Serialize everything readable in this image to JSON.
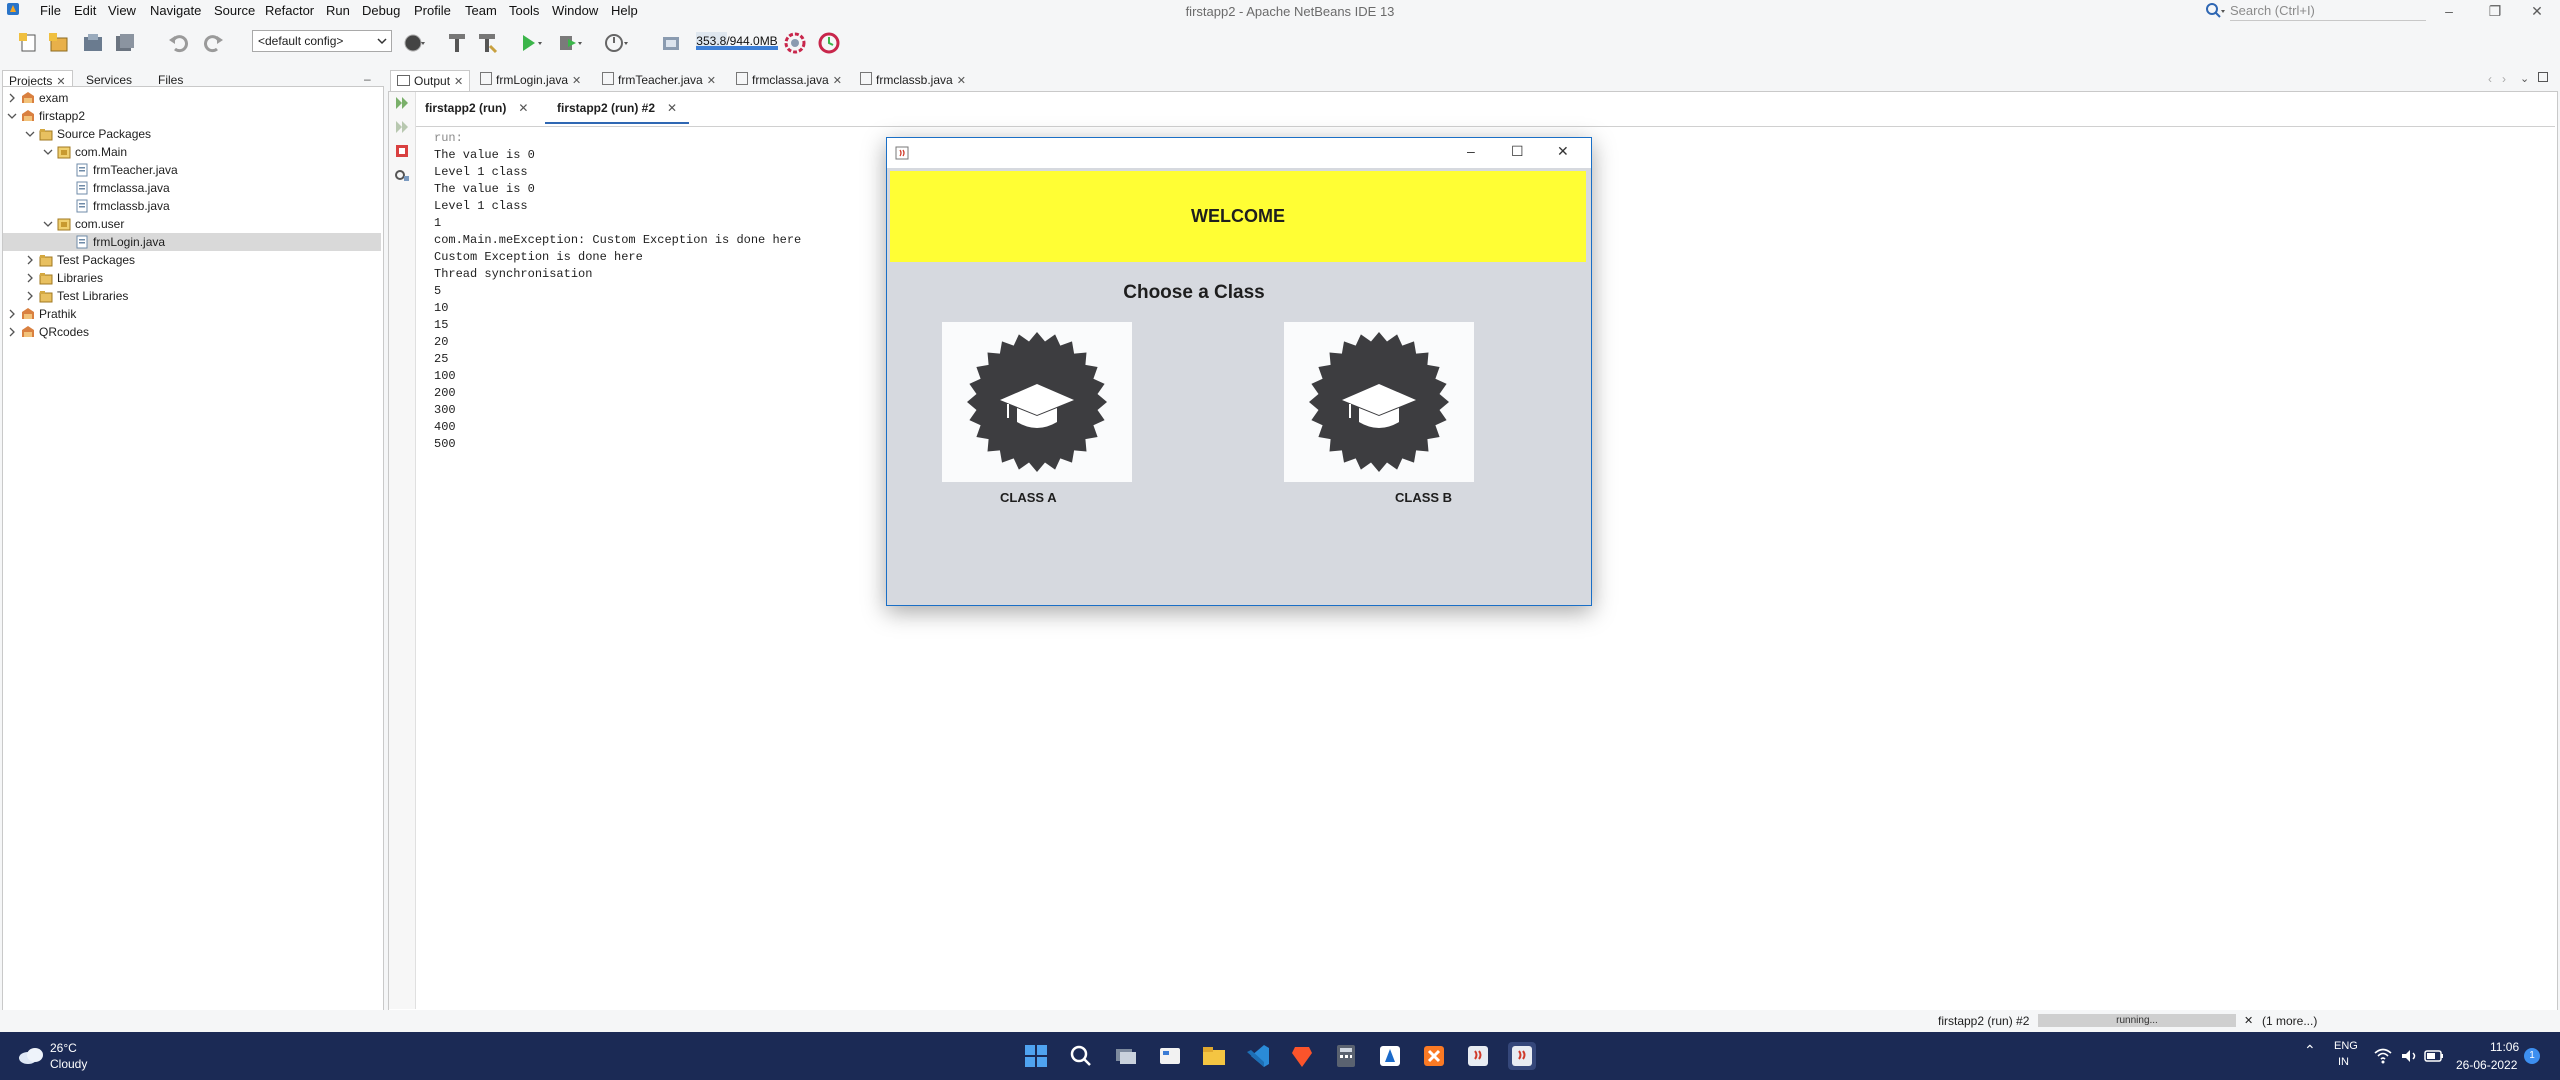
{
  "app": {
    "title": "firstapp2 - Apache NetBeans IDE 13",
    "menu": [
      "File",
      "Edit",
      "View",
      "Navigate",
      "Source",
      "Refactor",
      "Run",
      "Debug",
      "Profile",
      "Team",
      "Tools",
      "Window",
      "Help"
    ],
    "search_placeholder": "Search (Ctrl+I)",
    "window_controls": [
      "–",
      "❐",
      "✕"
    ]
  },
  "toolbar": {
    "config": "<default config>",
    "memory": "353.8/944.0MB",
    "memory_fraction": 0.375,
    "icons": [
      "new-file-icon",
      "new-project-icon",
      "open-project-icon",
      "save-all-icon",
      "undo-icon",
      "redo-icon",
      "globe-icon",
      "build-icon",
      "clean-build-icon",
      "run-icon",
      "debug-icon",
      "profile-icon",
      "memory-icon",
      "gc-icon",
      "profile-snapshot-icon"
    ]
  },
  "project_tabs": [
    {
      "label": "Projects",
      "active": true,
      "closable": true
    },
    {
      "label": "Services",
      "active": false,
      "closable": false
    },
    {
      "label": "Files",
      "active": false,
      "closable": false
    }
  ],
  "project_tree": [
    {
      "label": "exam",
      "depth": 0,
      "expanded": false,
      "icon": "project-icon"
    },
    {
      "label": "firstapp2",
      "depth": 0,
      "expanded": true,
      "icon": "project-icon"
    },
    {
      "label": "Source Packages",
      "depth": 1,
      "expanded": true,
      "icon": "folder-icon"
    },
    {
      "label": "com.Main",
      "depth": 2,
      "expanded": true,
      "icon": "package-icon"
    },
    {
      "label": "frmTeacher.java",
      "depth": 3,
      "icon": "java-file-icon"
    },
    {
      "label": "frmclassa.java",
      "depth": 3,
      "icon": "java-file-icon"
    },
    {
      "label": "frmclassb.java",
      "depth": 3,
      "icon": "java-file-icon"
    },
    {
      "label": "com.user",
      "depth": 2,
      "expanded": true,
      "icon": "package-icon"
    },
    {
      "label": "frmLogin.java",
      "depth": 3,
      "icon": "java-file-icon",
      "selected": true
    },
    {
      "label": "Test Packages",
      "depth": 1,
      "expanded": false,
      "icon": "folder-icon"
    },
    {
      "label": "Libraries",
      "depth": 1,
      "expanded": false,
      "icon": "folder-icon"
    },
    {
      "label": "Test Libraries",
      "depth": 1,
      "expanded": false,
      "icon": "folder-icon"
    },
    {
      "label": "Prathik",
      "depth": 0,
      "expanded": false,
      "icon": "project-icon"
    },
    {
      "label": "QRcodes",
      "depth": 0,
      "expanded": false,
      "icon": "project-icon"
    }
  ],
  "editor_tabs": [
    {
      "label": "Output",
      "active": true
    },
    {
      "label": "frmLogin.java",
      "active": false
    },
    {
      "label": "frmTeacher.java",
      "active": false
    },
    {
      "label": "frmclassa.java",
      "active": false
    },
    {
      "label": "frmclassb.java",
      "active": false
    }
  ],
  "output_tabs": [
    {
      "label": "firstapp2 (run)",
      "active": false
    },
    {
      "label": "firstapp2 (run) #2",
      "active": true
    }
  ],
  "output_lines": [
    "run:",
    "The value is 0",
    "Level 1 class",
    "The value is 0",
    "Level 1 class",
    "1",
    "com.Main.meException: Custom Exception is done here",
    "Custom Exception is done here",
    "Thread synchronisation",
    "5",
    "10",
    "15",
    "20",
    "25",
    "100",
    "200",
    "300",
    "400",
    "500"
  ],
  "status": {
    "task": "firstapp2 (run) #2",
    "progress_label": "running...",
    "more": "(1 more...)"
  },
  "dialog": {
    "welcome": "WELCOME",
    "choose": "Choose a Class",
    "class_a": "CLASS A",
    "class_b": "CLASS B",
    "banner_color": "#fffe34",
    "controls": [
      "–",
      "☐",
      "✕"
    ]
  },
  "taskbar": {
    "weather_temp": "26°C",
    "weather_desc": "Cloudy",
    "lang1": "ENG",
    "lang2": "IN",
    "time": "11:06",
    "date": "26-06-2022",
    "notif_count": "1"
  }
}
